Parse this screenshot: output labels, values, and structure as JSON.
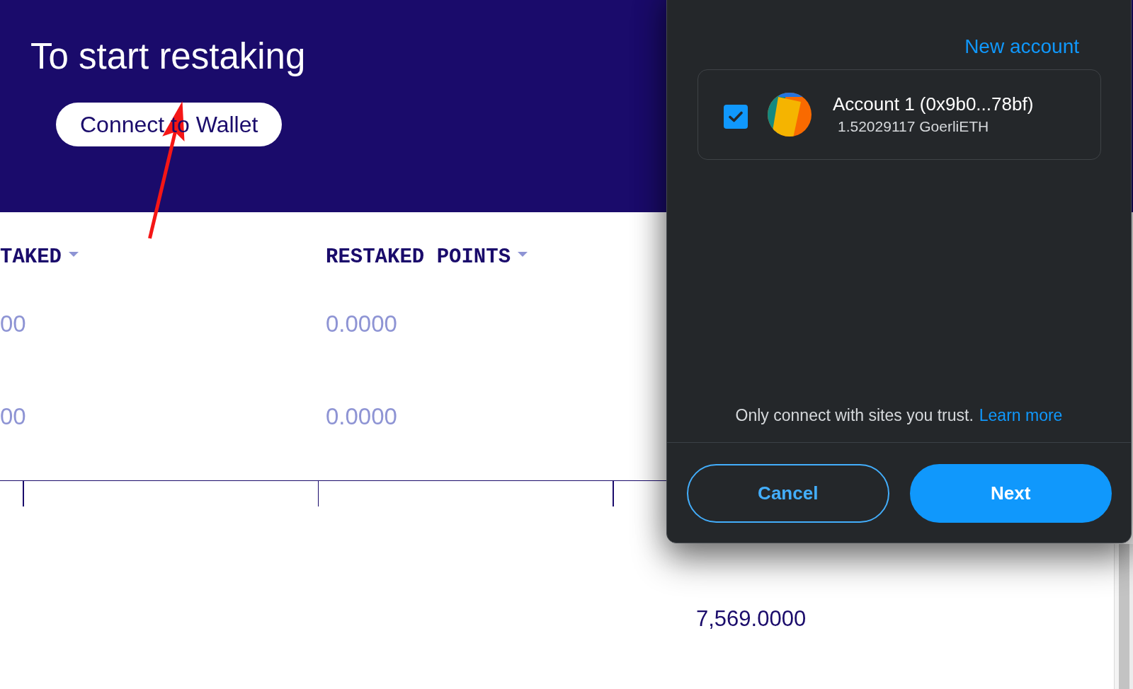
{
  "header": {
    "title": "To start restaking",
    "connect_button": "Connect to Wallet"
  },
  "table": {
    "columns": [
      {
        "label": "TAKED"
      },
      {
        "label": "RESTAKED POINTS"
      }
    ],
    "rows": [
      {
        "cells": [
          "00",
          "0.0000"
        ]
      },
      {
        "cells": [
          "00",
          "0.0000"
        ]
      }
    ]
  },
  "lower_table": {
    "cells": [
      "7,569.0000"
    ]
  },
  "connect_dialog": {
    "new_account_link": "New account",
    "accounts": [
      {
        "name": "Account 1 (0x9b0...78bf)",
        "balance": "1.52029117 GoerliETH",
        "checked": true
      }
    ],
    "notice": "Only connect with sites you trust.",
    "learn_more_link": "Learn more",
    "buttons": [
      {
        "label": "Cancel",
        "kind": "secondary"
      },
      {
        "label": "Next",
        "kind": "primary"
      }
    ]
  }
}
